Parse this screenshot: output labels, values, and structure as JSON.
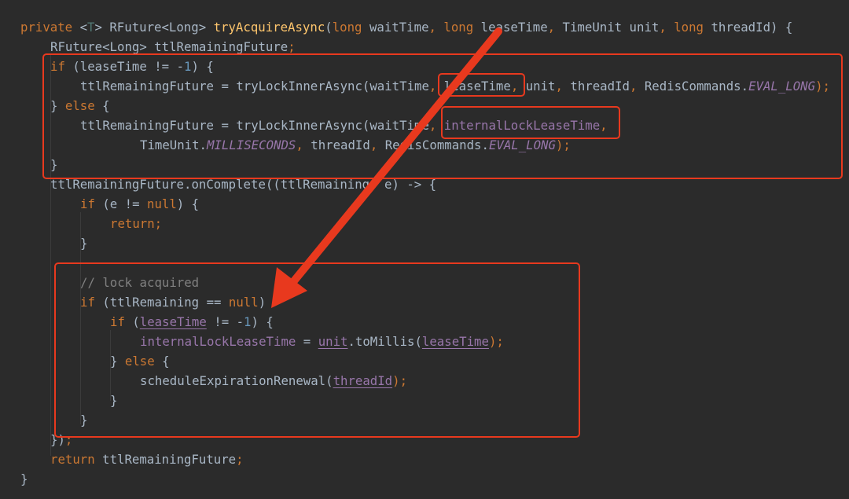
{
  "editor": {
    "lines": [
      {
        "indent": 0,
        "tokens": [
          {
            "t": "private ",
            "c": "kw"
          },
          {
            "t": "<",
            "c": ""
          },
          {
            "t": "T",
            "c": "gen"
          },
          {
            "t": "> RFuture<Long> ",
            "c": ""
          },
          {
            "t": "tryAcquireAsync",
            "c": "fn"
          },
          {
            "t": "(",
            "c": ""
          },
          {
            "t": "long ",
            "c": "kw"
          },
          {
            "t": "waitTime",
            "c": ""
          },
          {
            "t": ", ",
            "c": "kw"
          },
          {
            "t": "long ",
            "c": "kw"
          },
          {
            "t": "leaseTime",
            "c": ""
          },
          {
            "t": ", ",
            "c": "kw"
          },
          {
            "t": "TimeUnit unit",
            "c": ""
          },
          {
            "t": ", ",
            "c": "kw"
          },
          {
            "t": "long ",
            "c": "kw"
          },
          {
            "t": "threadId) {",
            "c": ""
          }
        ]
      },
      {
        "indent": 1,
        "tokens": [
          {
            "t": "RFuture<Long> ttlRemainingFuture",
            "c": ""
          },
          {
            "t": ";",
            "c": "kw"
          }
        ]
      },
      {
        "indent": 1,
        "tokens": [
          {
            "t": "if ",
            "c": "kw"
          },
          {
            "t": "(leaseTime != -",
            "c": ""
          },
          {
            "t": "1",
            "c": "num"
          },
          {
            "t": ") {",
            "c": ""
          }
        ]
      },
      {
        "indent": 2,
        "tokens": [
          {
            "t": "ttlRemainingFuture = tryLockInnerAsync(waitTime",
            "c": ""
          },
          {
            "t": ", ",
            "c": "kw"
          },
          {
            "t": "leaseTime",
            "c": ""
          },
          {
            "t": ", ",
            "c": "kw"
          },
          {
            "t": "unit",
            "c": ""
          },
          {
            "t": ", ",
            "c": "kw"
          },
          {
            "t": "threadId",
            "c": ""
          },
          {
            "t": ", ",
            "c": "kw"
          },
          {
            "t": "RedisCommands.",
            "c": ""
          },
          {
            "t": "EVAL_LONG",
            "c": "fld ital"
          },
          {
            "t": ");",
            "c": "kw"
          }
        ]
      },
      {
        "indent": 1,
        "tokens": [
          {
            "t": "} ",
            "c": ""
          },
          {
            "t": "else ",
            "c": "kw"
          },
          {
            "t": "{",
            "c": ""
          }
        ]
      },
      {
        "indent": 2,
        "tokens": [
          {
            "t": "ttlRemainingFuture = tryLockInnerAsync(waitTime",
            "c": ""
          },
          {
            "t": ", ",
            "c": "kw"
          },
          {
            "t": "internalLockLeaseTime",
            "c": "fld"
          },
          {
            "t": ",",
            "c": "kw"
          }
        ]
      },
      {
        "indent": 4,
        "tokens": [
          {
            "t": "TimeUnit.",
            "c": ""
          },
          {
            "t": "MILLISECONDS",
            "c": "fld ital"
          },
          {
            "t": ", ",
            "c": "kw"
          },
          {
            "t": "threadId",
            "c": ""
          },
          {
            "t": ", ",
            "c": "kw"
          },
          {
            "t": "RedisCommands.",
            "c": ""
          },
          {
            "t": "EVAL_LONG",
            "c": "fld ital"
          },
          {
            "t": ");",
            "c": "kw"
          }
        ]
      },
      {
        "indent": 1,
        "tokens": [
          {
            "t": "}",
            "c": ""
          }
        ]
      },
      {
        "indent": 1,
        "tokens": [
          {
            "t": "ttlRemainingFuture.onComplete((ttlRemaining",
            "c": ""
          },
          {
            "t": ", ",
            "c": "kw"
          },
          {
            "t": "e) -> {",
            "c": ""
          }
        ]
      },
      {
        "indent": 2,
        "tokens": [
          {
            "t": "if ",
            "c": "kw"
          },
          {
            "t": "(e != ",
            "c": ""
          },
          {
            "t": "null",
            "c": "kw"
          },
          {
            "t": ") {",
            "c": ""
          }
        ]
      },
      {
        "indent": 3,
        "tokens": [
          {
            "t": "return;",
            "c": "kw"
          }
        ]
      },
      {
        "indent": 2,
        "tokens": [
          {
            "t": "}",
            "c": ""
          }
        ]
      },
      {
        "indent": 0,
        "tokens": []
      },
      {
        "indent": 2,
        "tokens": [
          {
            "t": "// lock acquired",
            "c": "cmt"
          }
        ]
      },
      {
        "indent": 2,
        "tokens": [
          {
            "t": "if ",
            "c": "kw"
          },
          {
            "t": "(ttlRemaining == ",
            "c": ""
          },
          {
            "t": "null",
            "c": "kw"
          },
          {
            "t": ")",
            "c": ""
          }
        ]
      },
      {
        "indent": 3,
        "tokens": [
          {
            "t": "if ",
            "c": "kw"
          },
          {
            "t": "(",
            "c": ""
          },
          {
            "t": "leaseTime",
            "c": "fld ul"
          },
          {
            "t": " != -",
            "c": ""
          },
          {
            "t": "1",
            "c": "num"
          },
          {
            "t": ") {",
            "c": ""
          }
        ]
      },
      {
        "indent": 4,
        "tokens": [
          {
            "t": "internalLockLeaseTime",
            "c": "fld"
          },
          {
            "t": " = ",
            "c": ""
          },
          {
            "t": "unit",
            "c": "fld ul"
          },
          {
            "t": ".toMillis(",
            "c": ""
          },
          {
            "t": "leaseTime",
            "c": "fld ul"
          },
          {
            "t": ");",
            "c": "kw"
          }
        ]
      },
      {
        "indent": 3,
        "tokens": [
          {
            "t": "} ",
            "c": ""
          },
          {
            "t": "else ",
            "c": "kw"
          },
          {
            "t": "{",
            "c": ""
          }
        ]
      },
      {
        "indent": 4,
        "tokens": [
          {
            "t": "scheduleExpirationRenewal(",
            "c": ""
          },
          {
            "t": "threadId",
            "c": "fld ul"
          },
          {
            "t": ");",
            "c": "kw"
          }
        ]
      },
      {
        "indent": 3,
        "tokens": [
          {
            "t": "}",
            "c": ""
          }
        ]
      },
      {
        "indent": 2,
        "tokens": [
          {
            "t": "}",
            "c": ""
          }
        ]
      },
      {
        "indent": 1,
        "tokens": [
          {
            "t": "})",
            "c": ""
          },
          {
            "t": ";",
            "c": "kw"
          }
        ]
      },
      {
        "indent": 1,
        "tokens": [
          {
            "t": "return ",
            "c": "kw"
          },
          {
            "t": "ttlRemainingFuture",
            "c": ""
          },
          {
            "t": ";",
            "c": "kw"
          }
        ]
      },
      {
        "indent": 0,
        "tokens": [
          {
            "t": "}",
            "c": ""
          }
        ]
      }
    ]
  },
  "annotations": {
    "highlight_color": "#e8391e",
    "boxes": [
      "if-else-block",
      "lease-time-arg",
      "internal-lease-time-arg",
      "lock-acquired-block"
    ],
    "arrow": "arrow-to-lock-acquired"
  },
  "theme": {
    "background": "#2b2b2b",
    "text": "#a9b7c6",
    "keyword": "#cc7832",
    "method": "#ffc66d",
    "number": "#6897bb",
    "field": "#9876aa",
    "comment": "#808080"
  }
}
